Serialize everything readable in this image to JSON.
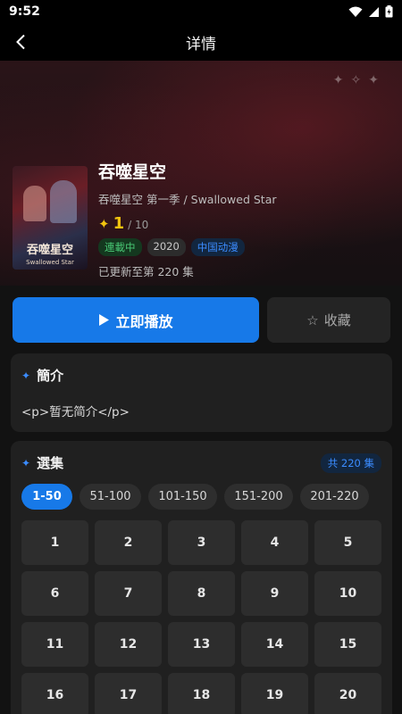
{
  "status_bar": {
    "time": "9:52"
  },
  "app_bar": {
    "title": "详情"
  },
  "show": {
    "title": "吞噬星空",
    "subtitle": "吞噬星空 第一季 / Swallowed Star",
    "rating": "1",
    "rating_max": "/ 10",
    "tags": [
      "連載中",
      "2020",
      "中国动漫"
    ],
    "updated": "已更新至第 220 集",
    "poster_title": "吞噬星空",
    "poster_subtitle": "Swallowed Star"
  },
  "actions": {
    "play_label": "立即播放",
    "favorite_label": "收藏"
  },
  "intro": {
    "header": "簡介",
    "text": "<p>暂无简介</p>"
  },
  "episodes": {
    "header": "選集",
    "total": "共 220 集",
    "ranges": [
      "1-50",
      "51-100",
      "101-150",
      "151-200",
      "201-220"
    ],
    "active_range": "1-50",
    "items": [
      "1",
      "2",
      "3",
      "4",
      "5",
      "6",
      "7",
      "8",
      "9",
      "10",
      "11",
      "12",
      "13",
      "14",
      "15",
      "16",
      "17",
      "18",
      "19",
      "20"
    ]
  },
  "colors": {
    "accent": "#1779e8",
    "rating": "#f1c40f",
    "tag_green": "#48c774",
    "tag_blue": "#3b8cff"
  },
  "icons": [
    "back-arrow-icon",
    "wifi-icon",
    "signal-icon",
    "battery-icon",
    "star-rating-icon",
    "play-icon",
    "star-outline-icon",
    "sparkle-icon"
  ]
}
